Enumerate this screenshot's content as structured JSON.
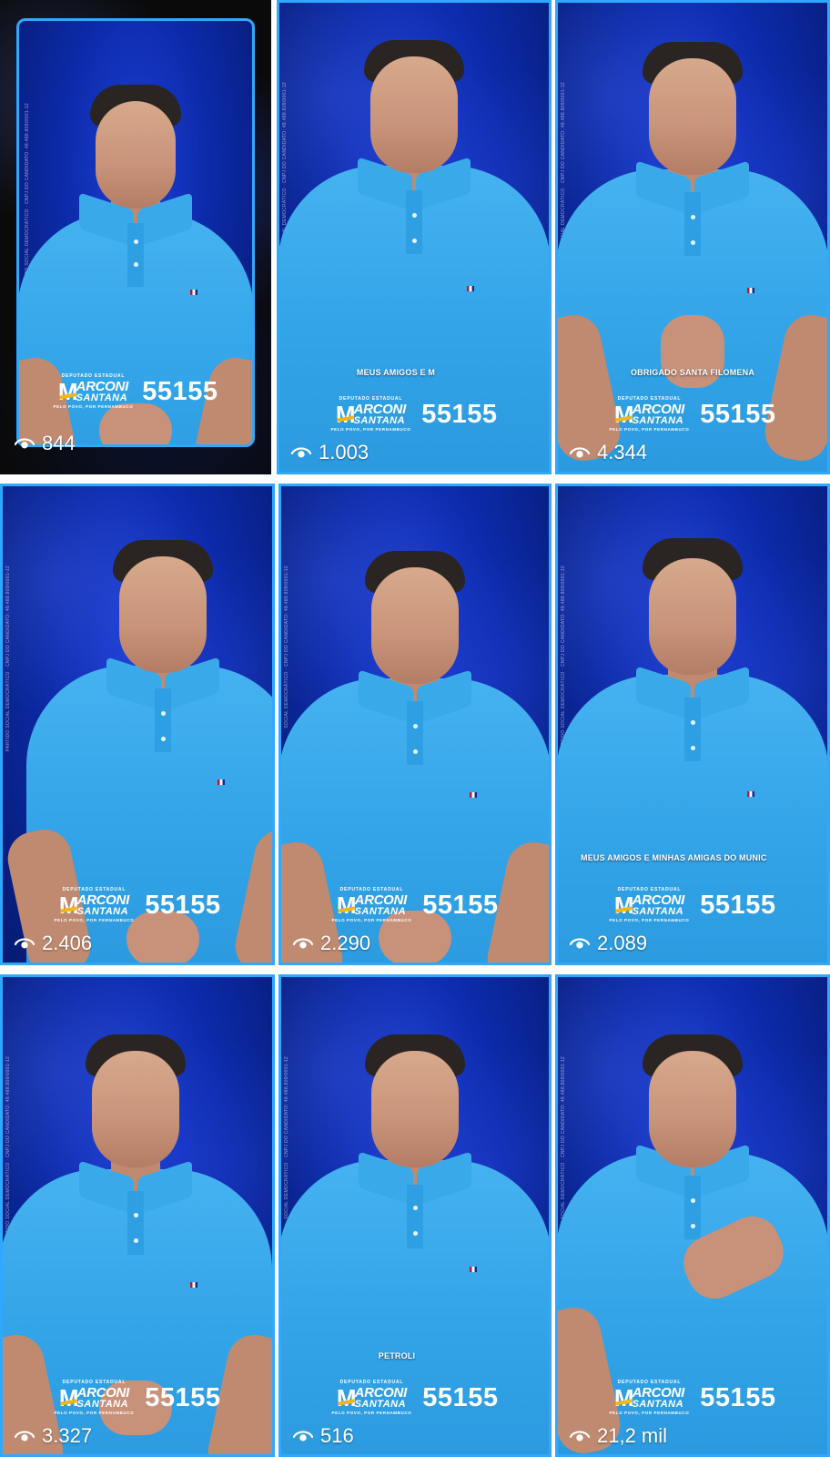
{
  "grid": {
    "tiles": [
      {
        "caption": "",
        "views": "844",
        "side_text": "PARTIDO SOCIAL DEMOCRÁTICO · CNPJ DO CANDIDATO: 48.488.809/0001-12",
        "pinned": true
      },
      {
        "caption": "MEUS AMIGOS E M",
        "views": "1.003",
        "side_text": "SOCIAL DEMOCRÁTICO · CNPJ DO CANDIDATO: 48.488.809/0001-12"
      },
      {
        "caption": "OBRIGADO SANTA FILOMENA",
        "views": "4.344",
        "side_text": "PARTIDO SOCIAL DEMOCRÁTICO · CNPJ DO CANDIDATO: 48.488.809/0001-12"
      },
      {
        "caption": "",
        "views": "2.406",
        "side_text": "PARTIDO SOCIAL DEMOCRÁTICO · CNPJ DO CANDIDATO: 48.488.809/0001-12"
      },
      {
        "caption": "",
        "views": "2.290",
        "side_text": "SOCIAL DEMOCRÁTICO · CNPJ DO CANDIDATO: 48.488.809/0001-12"
      },
      {
        "caption": "MEUS AMIGOS E MINHAS AMIGAS DO MUNIC",
        "views": "2.089",
        "side_text": "PARTIDO SOCIAL DEMOCRÁTICO · CNPJ DO CANDIDATO: 48.488.809/0001-12"
      },
      {
        "caption": "",
        "views": "3.327",
        "side_text": "PARTIDO SOCIAL DEMOCRÁTICO · CNPJ DO CANDIDATO: 48.488.809/0001-12"
      },
      {
        "caption": "PETROLI",
        "views": "516",
        "side_text": "SOCIAL DEMOCRÁTICO · CNPJ DO CANDIDATO: 48.488.809/0001-12"
      },
      {
        "caption": "",
        "views": "21,2 mil",
        "side_text": "PARTIDO SOCIAL DEMOCRÁTICO · CNPJ DO CANDIDATO: 48.488.809/0001-12"
      }
    ]
  },
  "brand": {
    "pre": "DEPUTADO ESTADUAL",
    "m": "M",
    "name1": "ARCONI",
    "name2": "SANTANA",
    "post": "PELO POVO, POR PERNAMBUCO",
    "number": "55155"
  },
  "colors": {
    "frame": "#2fa8ff",
    "background": "#0c2aa8",
    "shirt": "#33a4e8",
    "accent": "#f5b512"
  },
  "icons": {
    "views": "eye-icon"
  }
}
